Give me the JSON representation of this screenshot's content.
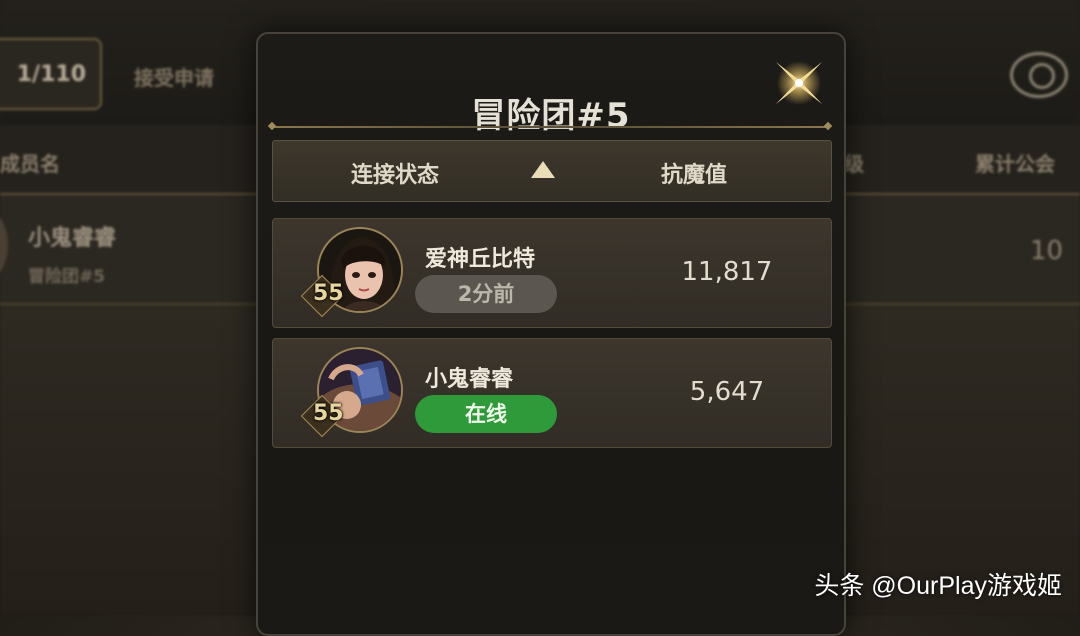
{
  "background": {
    "member_counter": "1/110",
    "accept_label": "接受申请",
    "columns": {
      "member": "成员名",
      "level": "级",
      "total": "累计公会"
    },
    "row": {
      "name": "小鬼睿睿",
      "team": "冒险团#5",
      "total": "10"
    }
  },
  "modal": {
    "title": "冒险团#5",
    "sort_bar": {
      "status_label": "连接状态",
      "resist_label": "抗魔值"
    },
    "members": [
      {
        "name": "爱神丘比特",
        "level": "55",
        "status": "2分前",
        "online": false,
        "score": "11,817"
      },
      {
        "name": "小鬼睿睿",
        "level": "55",
        "status": "在线",
        "online": true,
        "score": "5,647"
      }
    ]
  },
  "watermark": "头条 @OurPlay游戏姬",
  "colors": {
    "online": "#2f9a3a",
    "offline": "#5b5750",
    "gold": "#9b8456"
  },
  "icons": {
    "close": "close-star-icon",
    "sort": "sort-up-arrow-icon",
    "emblem": "guild-emblem-icon"
  }
}
